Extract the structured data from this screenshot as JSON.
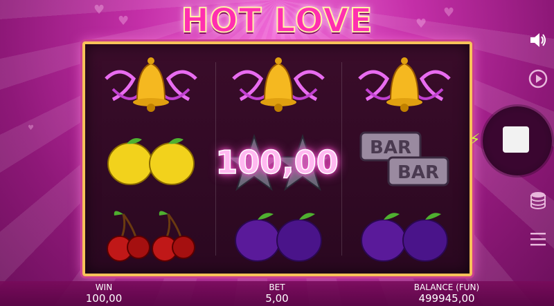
{
  "game": {
    "title": "HOT LOVE",
    "win_amount_display": "100,00"
  },
  "reels": [
    [
      "bell",
      "lemon",
      "cherry"
    ],
    [
      "bell",
      "star",
      "plum"
    ],
    [
      "bell",
      "bar",
      "plum"
    ]
  ],
  "bar_symbol": {
    "top": "BAR",
    "bottom": "BAR"
  },
  "footer": {
    "win_label": "WIN",
    "win_value": "100,00",
    "bet_label": "BET",
    "bet_value": "5,00",
    "balance_label": "BALANCE (FUN)",
    "balance_value": "499945,00"
  },
  "controls": {
    "sound_icon": "speaker-icon",
    "autoplay_icon": "replay-icon",
    "spin_icon": "stop-square-icon",
    "turbo_icon": "lightning-bolt-icon",
    "bet_icon": "coin-stack-icon",
    "menu_icon": "hamburger-menu-icon"
  },
  "colors": {
    "background": "#c42fa8",
    "frame": "#f7c25a",
    "win_text": "#ffb8f0",
    "bolt": "#c9ff3a"
  }
}
